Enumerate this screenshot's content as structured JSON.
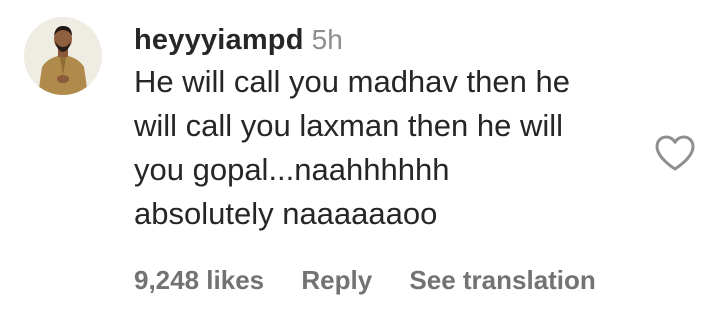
{
  "comment": {
    "username": "heyyyiampd",
    "timestamp": "5h",
    "text": "He will call you madhav then he\nwill call you laxman then he will\nyou gopal...naahhhhhh\nabsolutely naaaaaaoo",
    "actions": {
      "likes": "9,248 likes",
      "reply": "Reply",
      "see_translation": "See translation"
    },
    "icons": {
      "like": "heart-outline-icon"
    },
    "colors": {
      "text": "#262626",
      "secondary": "#8e8e8e",
      "action": "#737373"
    }
  }
}
